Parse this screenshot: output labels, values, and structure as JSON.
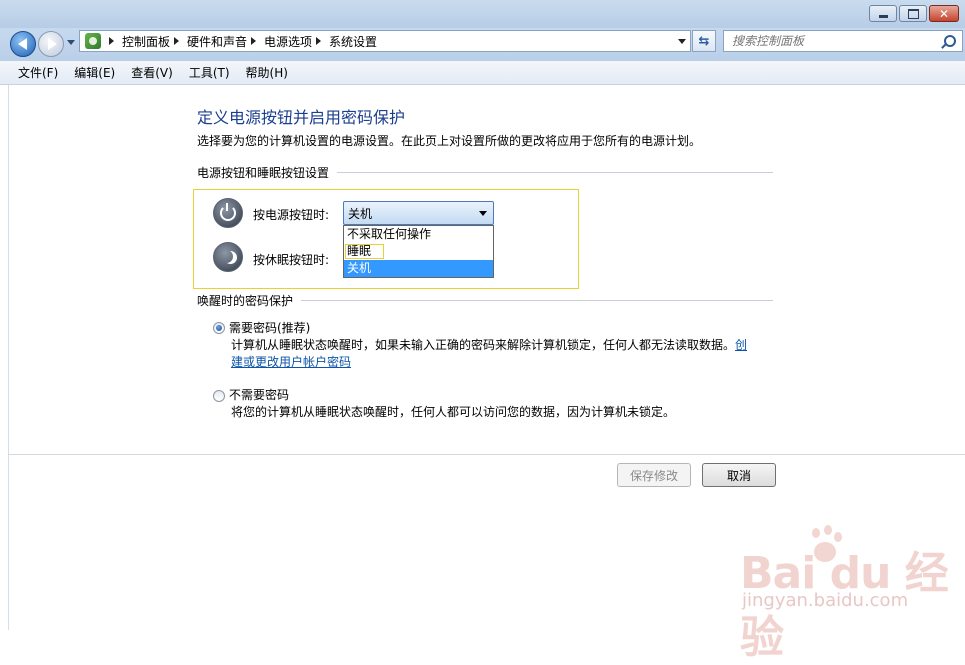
{
  "window": {
    "buttons": [
      "minimize",
      "maximize",
      "close"
    ]
  },
  "address": {
    "breadcrumbs": [
      "控制面板",
      "硬件和声音",
      "电源选项",
      "系统设置"
    ],
    "search_placeholder": "搜索控制面板"
  },
  "menu": [
    "文件(F)",
    "编辑(E)",
    "查看(V)",
    "工具(T)",
    "帮助(H)"
  ],
  "page": {
    "title": "定义电源按钮并启用密码保护",
    "description": "选择要为您的计算机设置的电源设置。在此页上对设置所做的更改将应用于您所有的电源计划。"
  },
  "buttons_section": {
    "heading": "电源按钮和睡眠按钮设置",
    "power_label": "按电源按钮时:",
    "sleep_label": "按休眠按钮时:",
    "power_value": "关机",
    "dropdown_options": [
      "不采取任何操作",
      "睡眠",
      "关机"
    ],
    "dropdown_selected_index": 2,
    "dropdown_hover_index": 1
  },
  "password_section": {
    "heading": "唤醒时的密码保护",
    "require": {
      "label": "需要密码(推荐)",
      "checked": true,
      "desc_line1": "计算机从睡眠状态唤醒时，如果未输入正确的密码来解除计算机锁定，任何人都无法读取数据。",
      "link_part1": "创",
      "link_part2": "建或更改用户帐户密码"
    },
    "no_require": {
      "label": "不需要密码",
      "checked": false,
      "desc": "将您的计算机从睡眠状态唤醒时，任何人都可以访问您的数据，因为计算机未锁定。"
    }
  },
  "actions": {
    "save": "保存修改",
    "cancel": "取消"
  },
  "watermark": {
    "logo_text": "Bai   du 经验",
    "url": "jingyan.baidu.com"
  },
  "colors": {
    "title_blue": "#1b3f8f",
    "link_blue": "#0b54a8",
    "highlight_yellow": "#e6d234",
    "selected_blue": "#3399ff"
  }
}
